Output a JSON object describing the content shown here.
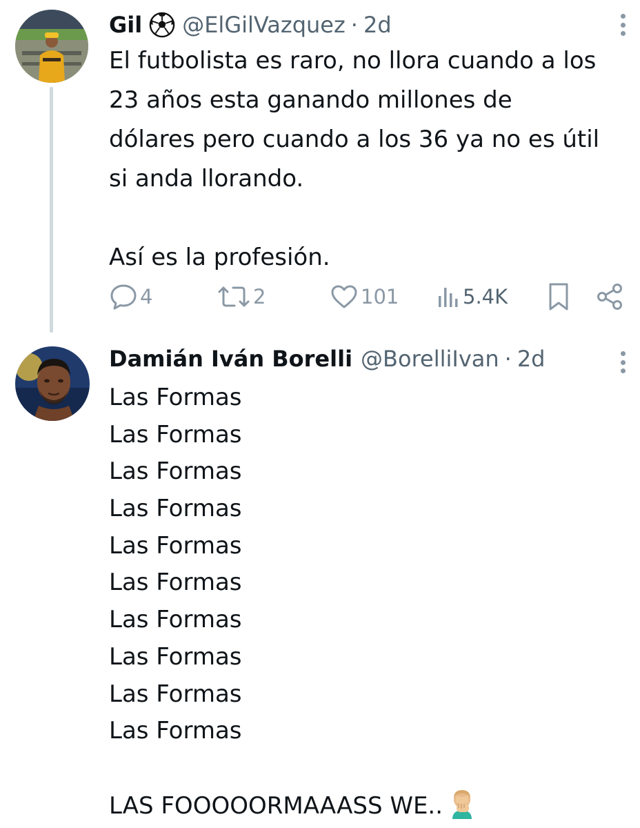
{
  "colors": {
    "text": "#0f1419",
    "secondary": "#536471",
    "icon": "#8a98a5",
    "thread_line": "#cfd9de"
  },
  "tweets": [
    {
      "name": "Gil",
      "badge": "soccer-ball-icon",
      "handle": "@ElGilVazquez",
      "separator": "·",
      "time": "2d",
      "lines": [
        "El futbolista es raro, no llora cuando a los",
        "23 años esta ganando millones de",
        "dólares pero cuando a los 36 ya no es útil",
        "si anda llorando.",
        "",
        "Así es la profesión."
      ],
      "actions": {
        "reply_icon": "speech-bubble-icon",
        "reply_count": "4",
        "retweet_icon": "retweet-icon",
        "retweet_count": "2",
        "like_icon": "heart-icon",
        "like_count": "101",
        "views_icon": "bar-chart-icon",
        "views_count": "5.4K",
        "bookmark_icon": "bookmark-icon",
        "share_icon": "share-icon"
      }
    },
    {
      "name": "Damián Iván Borelli",
      "handle": "@BorelliIvan",
      "separator": "·",
      "time": "2d",
      "lines": [
        "Las Formas",
        "Las Formas",
        "Las Formas",
        "Las Formas",
        "Las Formas",
        "Las Formas",
        "Las Formas",
        "Las Formas",
        "Las Formas",
        "Las Formas",
        "",
        "LAS FOOOOORMAAASS WE.."
      ],
      "end_emoji": "face-palm-emoji-icon"
    }
  ]
}
